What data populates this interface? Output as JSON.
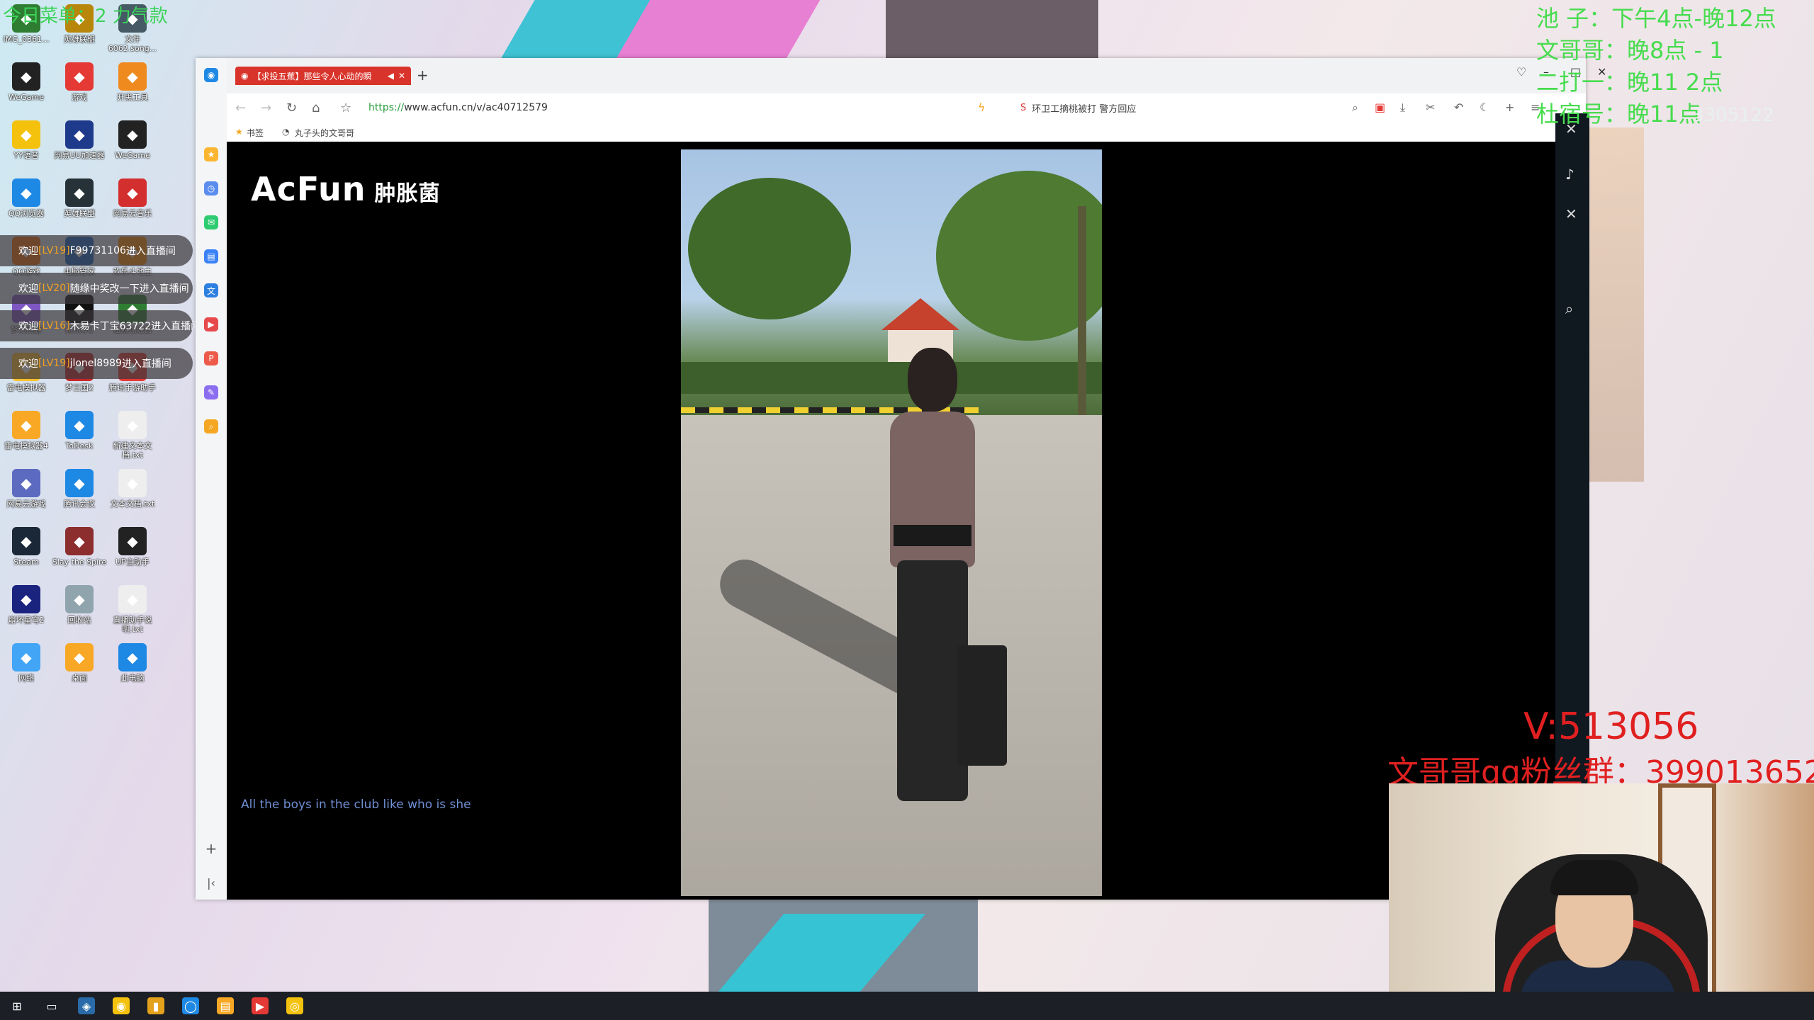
{
  "overlay": {
    "topleft_text": "今日菜单：2  力气款",
    "schedule": [
      "池    子：下午4点-晚12点",
      "文哥哥：晚8点 - 1",
      "二打一：晚11       2点",
      "杜宿号：晚11点"
    ],
    "room_number": "3305122",
    "v_text": "V:513056",
    "qq_group": "文哥哥qq粉丝群：399013652"
  },
  "desktop_icons": [
    {
      "label": "IMG_0361...",
      "icon": "image-icon",
      "color": "#2e7d32"
    },
    {
      "label": "英雄联盟",
      "icon": "lol-icon",
      "color": "#b8860b"
    },
    {
      "label": "文件 6062.song...",
      "icon": "music-file-icon",
      "color": "#455a64"
    },
    {
      "label": "WeGame",
      "icon": "wegame-icon",
      "color": "#222222"
    },
    {
      "label": "游戏",
      "icon": "game-icon",
      "color": "#e53935"
    },
    {
      "label": "开黑工具",
      "icon": "tool-icon",
      "color": "#ef8a1f"
    },
    {
      "label": "YY语音",
      "icon": "yy-icon",
      "color": "#f4c20d"
    },
    {
      "label": "网易UU加速器",
      "icon": "uu-icon",
      "color": "#1e3a8a"
    },
    {
      "label": "WeGame",
      "icon": "wegame-icon",
      "color": "#222222"
    },
    {
      "label": "QQ浏览器",
      "icon": "qq-browser-icon",
      "color": "#1e88e5"
    },
    {
      "label": "英雄联盟",
      "icon": "lol-icon",
      "color": "#263238"
    },
    {
      "label": "网易云音乐",
      "icon": "netease-music-icon",
      "color": "#d32f2f"
    },
    {
      "label": "QQ游戏",
      "icon": "qq-game-icon",
      "color": "#ef6c00"
    },
    {
      "label": "电脑管家",
      "icon": "pc-manager-icon",
      "color": "#1565c0"
    },
    {
      "label": "欢乐斗地主",
      "icon": "doudizhu-icon",
      "color": "#fb8c00"
    },
    {
      "label": "梦幻西游",
      "icon": "mhxy-icon",
      "color": "#7e57c2"
    },
    {
      "label": "腾讯QQ",
      "icon": "qq-icon",
      "color": "#111111"
    },
    {
      "label": "迅游加速器",
      "icon": "xunyou-icon",
      "color": "#2e7d32"
    },
    {
      "label": "雷电模拟器",
      "icon": "ldplayer-icon",
      "color": "#fbc02d"
    },
    {
      "label": "梦三国2",
      "icon": "m3g-icon",
      "color": "#c62828"
    },
    {
      "label": "腾讯手游助手",
      "icon": "tencent-assistant-icon",
      "color": "#e53935"
    },
    {
      "label": "雷电模拟器4",
      "icon": "ldplayer-icon",
      "color": "#f9a825"
    },
    {
      "label": "ToDesk",
      "icon": "todesk-icon",
      "color": "#1e88e5"
    },
    {
      "label": "新建文本文档.txt",
      "icon": "text-file-icon",
      "color": "#eeeeee"
    },
    {
      "label": "网易云游戏",
      "icon": "netease-cloud-icon",
      "color": "#5c6bc0"
    },
    {
      "label": "腾讯会议",
      "icon": "tencent-meeting-icon",
      "color": "#1e88e5"
    },
    {
      "label": "文本文档.txt",
      "icon": "text-file-icon",
      "color": "#eeeeee"
    },
    {
      "label": "Steam",
      "icon": "steam-icon",
      "color": "#1b2838"
    },
    {
      "label": "Slay the Spire",
      "icon": "slay-the-spire-icon",
      "color": "#8d2e2e"
    },
    {
      "label": "UP主助手",
      "icon": "up-assistant-icon",
      "color": "#222222"
    },
    {
      "label": "崩坏星穹2",
      "icon": "game-launcher-icon",
      "color": "#1a237e"
    },
    {
      "label": "回收站",
      "icon": "recycle-bin-icon",
      "color": "#90a4ae"
    },
    {
      "label": "直播助手说明.txt",
      "icon": "text-file-icon",
      "color": "#eeeeee"
    },
    {
      "label": "网络",
      "icon": "network-icon",
      "color": "#42a5f5"
    },
    {
      "label": "桌面",
      "icon": "folder-icon",
      "color": "#f9a825"
    },
    {
      "label": "此电脑",
      "icon": "computer-icon",
      "color": "#1e88e5"
    }
  ],
  "chat": [
    {
      "prefix": "欢迎",
      "level": "[LV19]",
      "user": "F99731106",
      "suffix": "进入直播间"
    },
    {
      "prefix": "欢迎",
      "level": "[LV20]",
      "user": "随缘中奖改一下",
      "suffix": "进入直播间"
    },
    {
      "prefix": "欢迎",
      "level": "[LV16]",
      "user": "木易卡丁宝63722",
      "suffix": "进入直播间"
    },
    {
      "prefix": "欢迎",
      "level": "[LV19]",
      "user": "jlonel8989",
      "suffix": "进入直播间"
    }
  ],
  "browser": {
    "tab_title": "【求投五蕉】那些令人心动的瞬",
    "url_scheme": "https://",
    "url_rest": "www.acfun.cn/v/ac40712579",
    "search_text": "环卫工摘桃被打 警方回应",
    "bookmarks": [
      "书签",
      "丸子头的文哥哥"
    ]
  },
  "page": {
    "logo": "AcFun",
    "logo_sub": "肿胀菌",
    "subtitle": "All the boys in the club like who is she"
  },
  "taskbar_icons": [
    "windows-start-icon",
    "task-view-icon",
    "stream-app-icon",
    "chrome-icon",
    "file-app-icon",
    "qq-browser-icon",
    "file-explorer-icon",
    "wps-icon",
    "yy-icon"
  ]
}
